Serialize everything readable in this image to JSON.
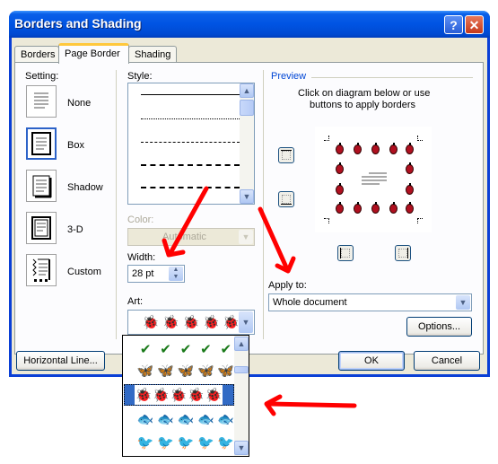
{
  "window": {
    "title": "Borders and Shading",
    "help_label": "?",
    "close_label": "✕"
  },
  "tabs": [
    {
      "label": "Borders",
      "active": false
    },
    {
      "label": "Page Border",
      "active": true
    },
    {
      "label": "Shading",
      "active": false
    }
  ],
  "setting": {
    "label": "Setting:",
    "options": [
      {
        "label": "None",
        "selected": false
      },
      {
        "label": "Box",
        "selected": true
      },
      {
        "label": "Shadow",
        "selected": false
      },
      {
        "label": "3-D",
        "selected": false
      },
      {
        "label": "Custom",
        "selected": false
      }
    ]
  },
  "style": {
    "label": "Style:",
    "lines": [
      "solid",
      "dotted",
      "dashed-small",
      "dashed",
      "dash-dot"
    ]
  },
  "color": {
    "label": "Color:",
    "value": "Automatic",
    "disabled": true
  },
  "width": {
    "label": "Width:",
    "value": "28 pt"
  },
  "art": {
    "label": "Art:",
    "selected": "ladybugs",
    "options": [
      "leaves",
      "butterflies-purple",
      "ladybugs",
      "fish",
      "birds-navy"
    ],
    "selected_index": 2
  },
  "preview": {
    "label": "Preview",
    "instructions_line1": "Click on diagram below or use",
    "instructions_line2": "buttons to apply borders",
    "buttons": [
      "top-border",
      "bottom-border",
      "left-border",
      "right-border"
    ]
  },
  "apply_to": {
    "label": "Apply to:",
    "value": "Whole document"
  },
  "buttons": {
    "options": "Options...",
    "horizontal_line": "Horizontal Line...",
    "ok": "OK",
    "cancel": "Cancel"
  },
  "annotation": {
    "arrow_color": "#ff0000"
  }
}
